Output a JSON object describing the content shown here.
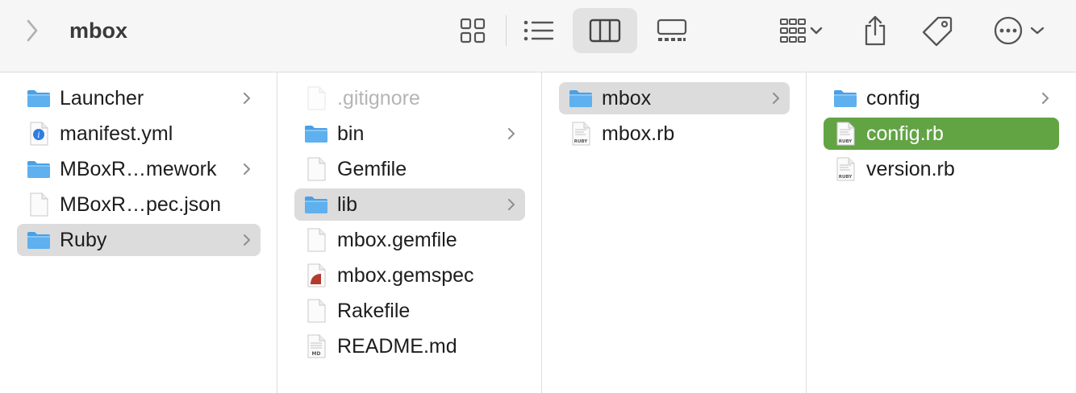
{
  "window": {
    "title": "mbox"
  },
  "toolbar": {
    "back_icon": "chevron-left-icon",
    "views": [
      {
        "name": "icon-view",
        "icon": "grid-icon",
        "active": false
      },
      {
        "name": "list-view",
        "icon": "list-icon",
        "active": false
      },
      {
        "name": "column-view",
        "icon": "columns-icon",
        "active": true
      },
      {
        "name": "gallery-view",
        "icon": "gallery-icon",
        "active": false
      }
    ],
    "group_icon": "group-by-icon",
    "share_icon": "share-icon",
    "tag_icon": "tag-icon",
    "more_icon": "ellipsis-circle-icon"
  },
  "colors": {
    "toolbar_bg": "#f6f6f6",
    "selection_grey": "#dcdcdc",
    "selection_accent": "#62a344",
    "folder_blue": "#5eb0ee"
  },
  "columns": [
    {
      "items": [
        {
          "label": "Launcher",
          "icon": "folder-icon",
          "chevron": true,
          "state": "normal"
        },
        {
          "label": "manifest.yml",
          "icon": "yml-file-icon",
          "chevron": false,
          "state": "normal"
        },
        {
          "label": "MBoxR…mework",
          "icon": "folder-icon",
          "chevron": true,
          "state": "normal"
        },
        {
          "label": "MBoxR…pec.json",
          "icon": "file-icon",
          "chevron": false,
          "state": "normal"
        },
        {
          "label": "Ruby",
          "icon": "folder-icon",
          "chevron": true,
          "state": "selected"
        }
      ]
    },
    {
      "items": [
        {
          "label": ".gitignore",
          "icon": "file-icon",
          "chevron": false,
          "state": "dimmed"
        },
        {
          "label": "bin",
          "icon": "folder-icon",
          "chevron": true,
          "state": "normal"
        },
        {
          "label": "Gemfile",
          "icon": "file-icon",
          "chevron": false,
          "state": "normal"
        },
        {
          "label": "lib",
          "icon": "folder-icon",
          "chevron": true,
          "state": "selected"
        },
        {
          "label": "mbox.gemfile",
          "icon": "file-icon",
          "chevron": false,
          "state": "normal"
        },
        {
          "label": "mbox.gemspec",
          "icon": "gemspec-file-icon",
          "chevron": false,
          "state": "normal"
        },
        {
          "label": "Rakefile",
          "icon": "file-icon",
          "chevron": false,
          "state": "normal"
        },
        {
          "label": "README.md",
          "icon": "md-file-icon",
          "chevron": false,
          "state": "normal"
        }
      ]
    },
    {
      "items": [
        {
          "label": "mbox",
          "icon": "folder-icon",
          "chevron": true,
          "state": "selected"
        },
        {
          "label": "mbox.rb",
          "icon": "ruby-file-icon",
          "chevron": false,
          "state": "normal"
        }
      ]
    },
    {
      "items": [
        {
          "label": "config",
          "icon": "folder-icon",
          "chevron": true,
          "state": "normal"
        },
        {
          "label": "config.rb",
          "icon": "ruby-file-icon",
          "chevron": false,
          "state": "active"
        },
        {
          "label": "version.rb",
          "icon": "ruby-file-icon",
          "chevron": false,
          "state": "normal"
        }
      ]
    }
  ],
  "file_badges": {
    "ruby": "RUBY",
    "markdown": "MD"
  }
}
